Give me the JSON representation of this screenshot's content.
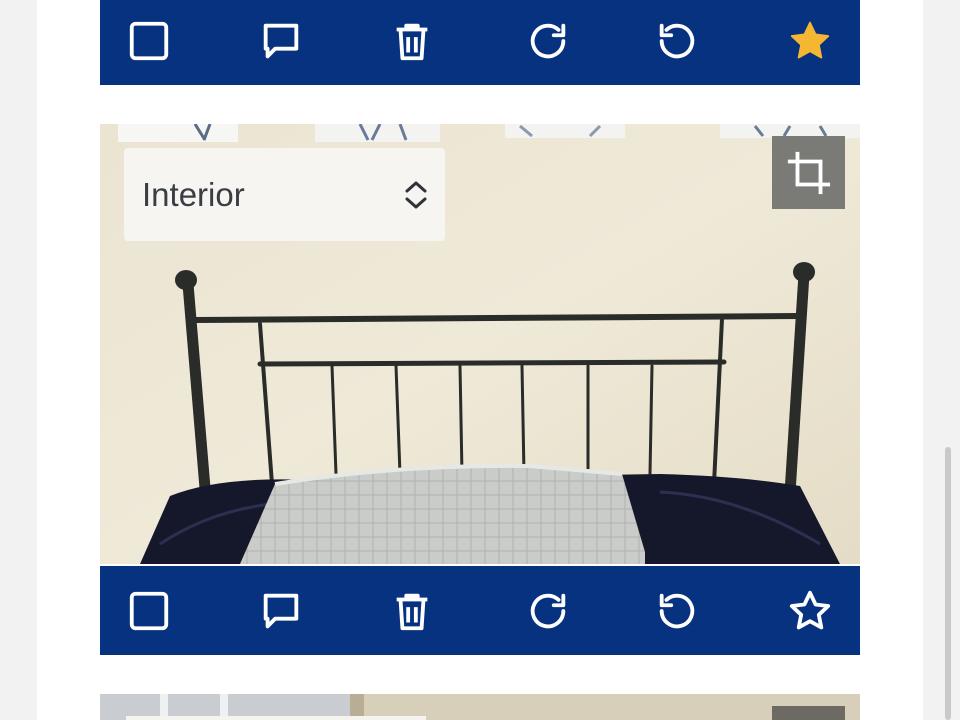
{
  "cards": [
    {
      "toolbar": {
        "buttons": [
          {
            "icon": "checkbox-icon"
          },
          {
            "icon": "comment-icon"
          },
          {
            "icon": "trash-icon"
          },
          {
            "icon": "rotate-clockwise-icon"
          },
          {
            "icon": "rotate-counterclockwise-icon"
          },
          {
            "icon": "star-icon",
            "favorited": true,
            "color": "#f5b731"
          }
        ]
      }
    },
    {
      "photo": {
        "category": "Interior",
        "crop_icon": "crop-icon"
      },
      "toolbar": {
        "buttons": [
          {
            "icon": "checkbox-icon"
          },
          {
            "icon": "comment-icon"
          },
          {
            "icon": "trash-icon"
          },
          {
            "icon": "rotate-clockwise-icon"
          },
          {
            "icon": "rotate-counterclockwise-icon"
          },
          {
            "icon": "star-icon",
            "favorited": false,
            "color": "#ffffff"
          }
        ]
      }
    }
  ],
  "colors": {
    "toolbar_bg": "#063280",
    "icon": "#ffffff",
    "star_active": "#f5b731"
  }
}
